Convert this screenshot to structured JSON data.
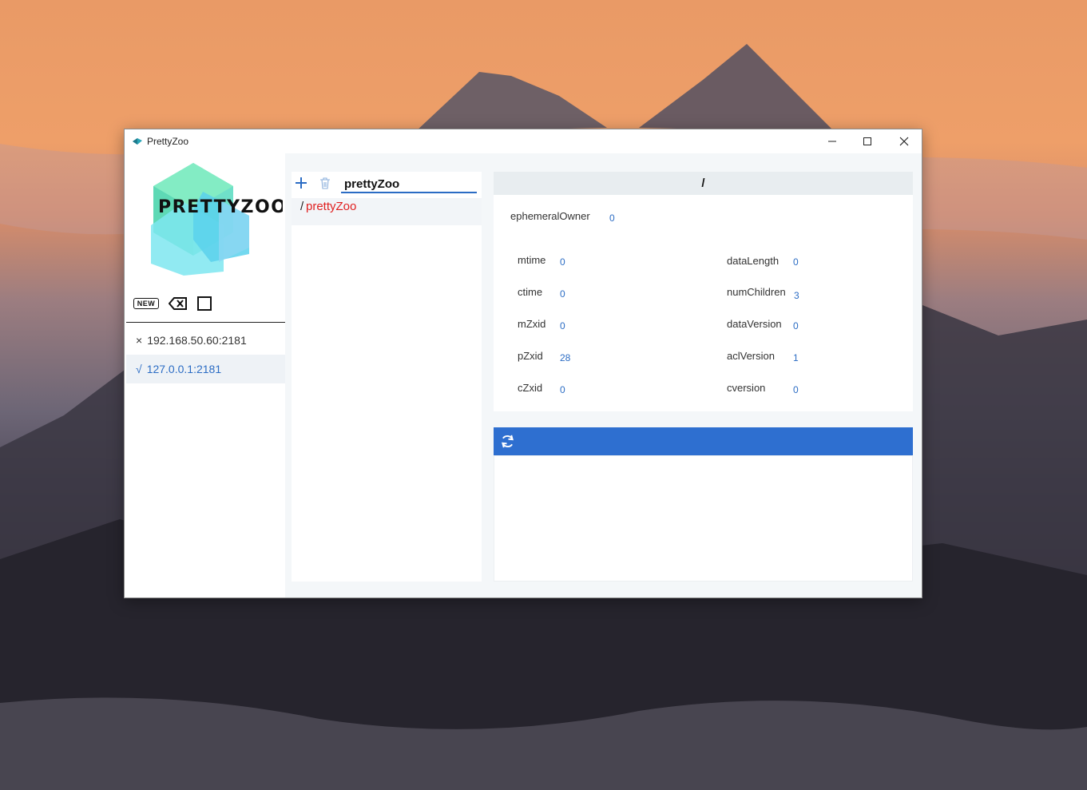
{
  "window": {
    "title": "PrettyZoo",
    "controls": {
      "minimize": "─",
      "maximize": "☐",
      "close": "✕"
    }
  },
  "logo": {
    "text": "PRETTYZOO"
  },
  "left_toolbar": {
    "new_label": "NEW"
  },
  "servers": [
    {
      "mark": "×",
      "address": "192.168.50.60:2181",
      "connected": false
    },
    {
      "mark": "√",
      "address": "127.0.0.1:2181",
      "connected": true
    }
  ],
  "tree": {
    "search_value": "prettyZoo",
    "nodes": [
      {
        "prefix": "/",
        "name": "prettyZoo"
      }
    ]
  },
  "node_detail": {
    "path": "/",
    "ephemeralOwner": {
      "label": "ephemeralOwner",
      "value": "0"
    },
    "left_stats": [
      {
        "label": "mtime",
        "value": "0"
      },
      {
        "label": "ctime",
        "value": "0"
      },
      {
        "label": "mZxid",
        "value": "0"
      },
      {
        "label": "pZxid",
        "value": "28"
      },
      {
        "label": "cZxid",
        "value": "0"
      }
    ],
    "right_stats": [
      {
        "label": "dataLength",
        "value": "0"
      },
      {
        "label": "numChildren",
        "value": "3"
      },
      {
        "label": "dataVersion",
        "value": "0"
      },
      {
        "label": "aclVersion",
        "value": "1"
      },
      {
        "label": "cversion",
        "value": "0"
      }
    ]
  },
  "colors": {
    "accent": "#2e6fd0",
    "link": "#2b6cc4",
    "node_name": "#e02020"
  },
  "icons": [
    "app-icon",
    "new-icon",
    "clear-icon",
    "square-icon",
    "plus-icon",
    "trash-icon",
    "refresh-icon"
  ]
}
